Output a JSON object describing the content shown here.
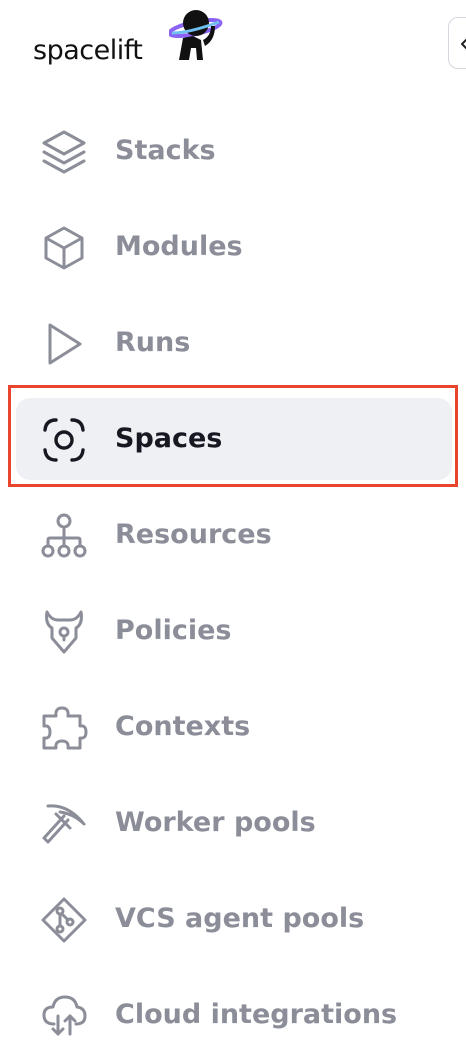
{
  "brand": {
    "name": "spacelift"
  },
  "nav": {
    "items": [
      {
        "label": "Stacks",
        "icon": "layers-icon"
      },
      {
        "label": "Modules",
        "icon": "cube-icon"
      },
      {
        "label": "Runs",
        "icon": "play-icon"
      },
      {
        "label": "Spaces",
        "icon": "focus-target-icon",
        "active": true
      },
      {
        "label": "Resources",
        "icon": "hierarchy-icon"
      },
      {
        "label": "Policies",
        "icon": "shield-horns-icon"
      },
      {
        "label": "Contexts",
        "icon": "puzzle-icon"
      },
      {
        "label": "Worker pools",
        "icon": "pickaxe-icon"
      },
      {
        "label": "VCS agent pools",
        "icon": "git-diamond-icon"
      },
      {
        "label": "Cloud integrations",
        "icon": "cloud-transfer-icon"
      }
    ]
  },
  "colors": {
    "inactive_text": "#8b8e98",
    "active_text": "#171821",
    "active_bg": "#eff0f3",
    "highlight_border": "#e8452c",
    "mascot_ring": "#8a63f5"
  }
}
